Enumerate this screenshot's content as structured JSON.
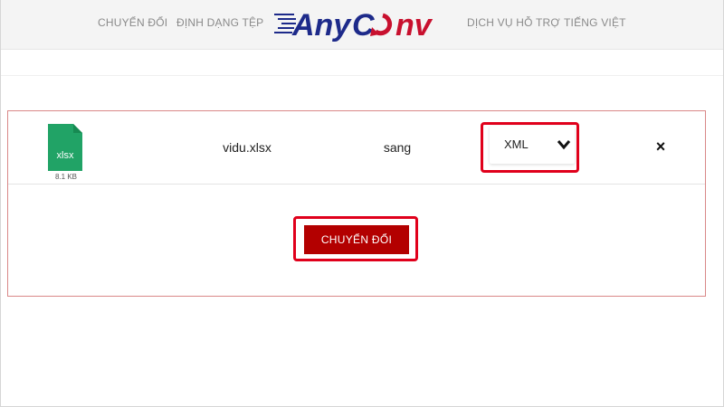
{
  "header": {
    "nav_left": [
      "CHUYỂN ĐỔI",
      "ĐỊNH DẠNG TỆP"
    ],
    "nav_right": [
      "DỊCH VỤ HỖ TRỢ",
      "TIẾNG VIỆT"
    ],
    "logo": {
      "part1": "Any",
      "part2": "C",
      "part3": "nv"
    }
  },
  "file": {
    "icon_label": "xlsx",
    "size": "8.1 KB",
    "name": "vidu.xlsx"
  },
  "to_word": "sang",
  "format_select": {
    "value": "XML"
  },
  "actions": {
    "remove": "×",
    "convert_label": "CHUYỂN ĐỔI"
  },
  "colors": {
    "brand_blue": "#1d2a8a",
    "brand_red": "#c8102e",
    "button_red": "#b30000",
    "highlight_red": "#e0001b",
    "file_green": "#21a366"
  }
}
